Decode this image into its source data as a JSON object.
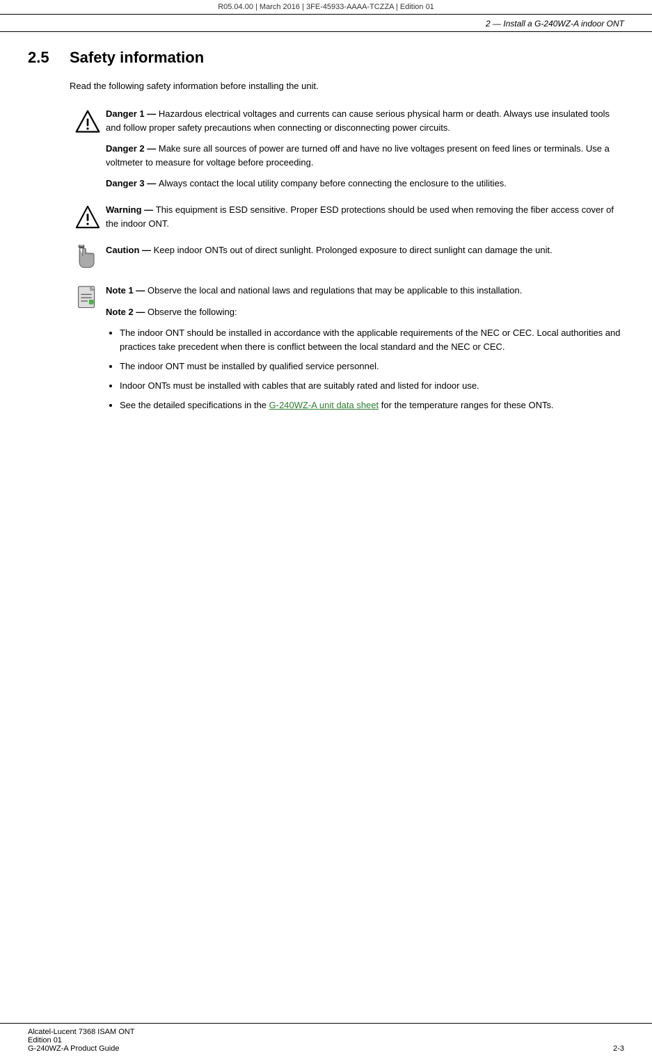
{
  "header": {
    "text": "R05.04.00 | March 2016 | 3FE-45933-AAAA-TCZZA | Edition 01"
  },
  "subheader": {
    "text": "2 — Install a G-240WZ-A indoor ONT"
  },
  "section": {
    "number": "2.5",
    "title": "Safety information"
  },
  "intro": {
    "text": "Read the following safety information before installing the unit."
  },
  "notices": [
    {
      "type": "danger",
      "items": [
        {
          "label": "Danger 1 — ",
          "text": "Hazardous electrical voltages and currents can cause serious physical harm or death. Always use insulated tools and follow proper safety precautions when connecting or disconnecting power circuits."
        },
        {
          "label": "Danger 2 — ",
          "text": "Make sure all sources of power are turned off and have no live voltages present on feed lines or terminals. Use a voltmeter to measure for voltage before proceeding."
        },
        {
          "label": "Danger 3 — ",
          "text": "Always contact the local utility company before connecting the enclosure to the utilities."
        }
      ]
    },
    {
      "type": "warning",
      "items": [
        {
          "label": "Warning — ",
          "text": "This equipment is ESD sensitive. Proper ESD protections should be used when removing the fiber access cover of the indoor ONT."
        }
      ]
    },
    {
      "type": "caution",
      "items": [
        {
          "label": "Caution — ",
          "text": "Keep indoor ONTs out of direct sunlight. Prolonged exposure to direct sunlight can damage the unit."
        }
      ]
    },
    {
      "type": "note",
      "items": [
        {
          "label": "Note 1 — ",
          "text": "Observe the local and national laws and regulations that may be applicable to this installation."
        },
        {
          "label": "Note 2 — ",
          "text": "Observe the following:"
        }
      ],
      "bullets": [
        "The indoor ONT should be installed in accordance with the applicable requirements of the NEC or CEC. Local authorities and practices take precedent when there is conflict between the local standard and the NEC or CEC.",
        "The indoor ONT must be installed by qualified service personnel.",
        "Indoor ONTs must be installed with cables that are suitably rated and listed for indoor use.",
        "See the detailed specifications in the G-240WZ-A unit data sheet for the temperature ranges for these ONTs."
      ],
      "bullet_link_text": "G-240WZ-A unit data sheet"
    }
  ],
  "footer": {
    "line1": "Alcatel-Lucent 7368 ISAM ONT",
    "line2": "Edition 01",
    "line3": "G-240WZ-A Product Guide",
    "page": "2-3"
  }
}
